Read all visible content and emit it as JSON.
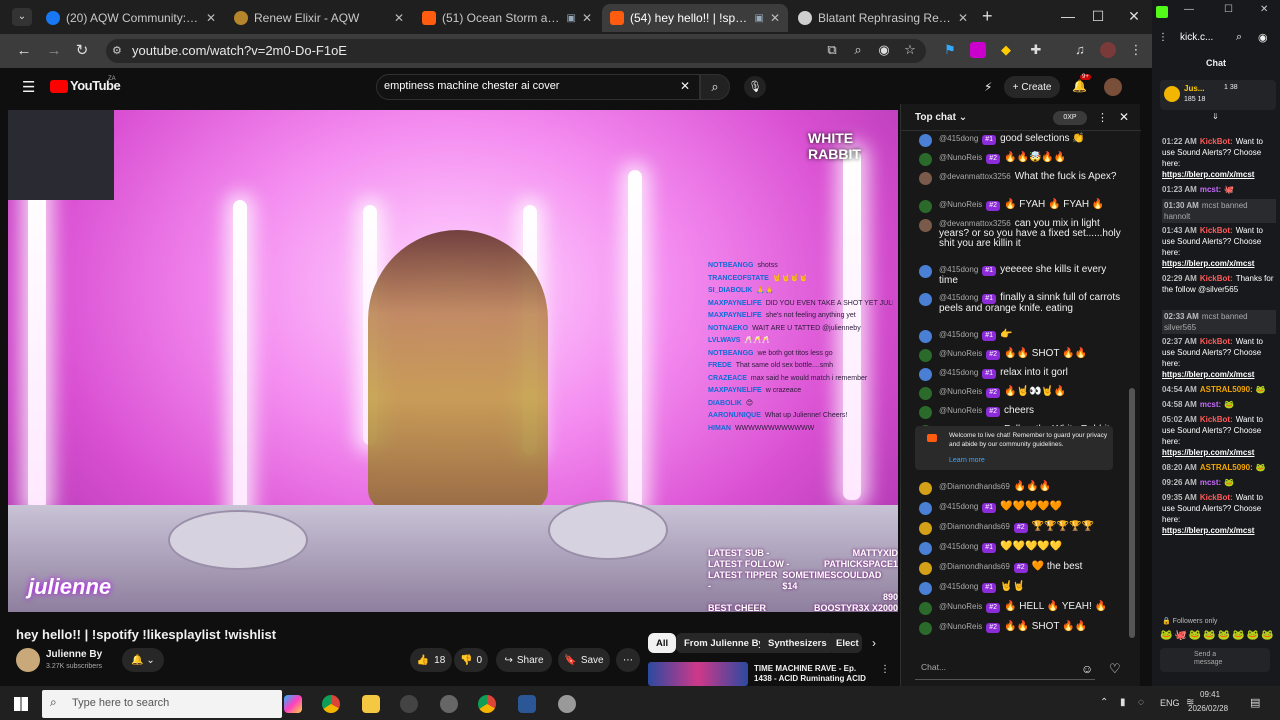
{
  "browser": {
    "tabs": [
      {
        "title": "(20) AQW Community: 🧡 LOV",
        "favicon_color": "#1877f2"
      },
      {
        "title": "Renew Elixir - AQW",
        "favicon_color": "#b5852b"
      },
      {
        "title": "(51) Ocean Storm and Rain",
        "favicon_color": "#ff5c10"
      },
      {
        "title": "(54) hey hello!! | !spotify !li",
        "favicon_color": "#ff5c10"
      },
      {
        "title": "Blatant Rephrasing Request",
        "favicon_color": "#cfcfcf"
      }
    ],
    "new_tab": "+",
    "url": "youtube.com/watch?v=2m0-Do-F1oE"
  },
  "youtube": {
    "logo": "YouTube",
    "logo_sup": "ZA",
    "search_query": "emptiness machine chester ai cover",
    "create_label": "Create",
    "notif_count": "9+",
    "video": {
      "brand_overlay": "WHITE RABBIT",
      "stream_overlay_chat": [
        {
          "user": "NOTBEANGG",
          "text": "shotss"
        },
        {
          "user": "TRANCEOFSTATE",
          "text": "🤘🤘🤘🤘"
        },
        {
          "user": "SI_DIABOLIK",
          "text": "🙏🙏"
        },
        {
          "user": "MAXPAYNELIFE",
          "text": "DID YOU EVEN TAKE A SHOT YET JULI?"
        },
        {
          "user": "MAXPAYNELIFE",
          "text": "she's not feeling anything yet"
        },
        {
          "user": "NOTNAEKO",
          "text": "WAIT ARE U TATTED @julienneby"
        },
        {
          "user": "LVLWAVS",
          "text": "🥂🥂🥂"
        },
        {
          "user": "NOTBEANGG",
          "text": "we both got titos less go"
        },
        {
          "user": "FREDE",
          "text": "That same old sex bottle....smh"
        },
        {
          "user": "CRAZEACE",
          "text": "max said he would match i remember"
        },
        {
          "user": "MAXPAYNELIFE",
          "text": "w crazeace"
        },
        {
          "user": "DIABOLIK",
          "text": "😊"
        },
        {
          "user": "AARONUNIQUE",
          "text": "What up Julienne! Cheers!"
        },
        {
          "user": "HIMAN",
          "text": "WWWWWWWWWWWW"
        }
      ],
      "stream_stats": [
        {
          "label": "LATEST SUB -",
          "value": "MATTYXID"
        },
        {
          "label": "LATEST FOLLOW -",
          "value": "PATHICKSPACE1"
        },
        {
          "label": "LATEST TIPPER -",
          "value": "SOMETIMESCOULDAD $14"
        },
        {
          "label": "",
          "value": "890"
        },
        {
          "label": "BEST CHEER",
          "value": "BOOSTYR3X X2000"
        }
      ],
      "caption_logo": "julienne"
    },
    "title": "hey hello!! | !spotify !likesplaylist !wishlist",
    "channel": "Julienne By",
    "subscribers": "3.27K subscribers",
    "likes": "18",
    "dislikes": "0",
    "share": "Share",
    "save": "Save",
    "chips": [
      "All",
      "From Julienne By",
      "Synthesizers",
      "Elect"
    ],
    "recommended_title": "TIME MACHINE RAVE - Ep. 1438 - ACID Ruminating ACID ..."
  },
  "livechat": {
    "header": "Top chat",
    "points": "0XP",
    "messages": [
      {
        "user": "@415dong",
        "badge": "#1",
        "text": "good selections 👏",
        "av": "#4a7fd6"
      },
      {
        "user": "@NunoReis",
        "badge": "#2",
        "text": "🔥🔥🤯🔥🔥",
        "av": "#2a6a2a"
      },
      {
        "user": "@devanmattox3256",
        "badge": "",
        "text": "What the fuck is Apex?",
        "av": "#7a5a4a"
      },
      {
        "user": "@NunoReis",
        "badge": "#2",
        "text": "🔥 FYAH 🔥 FYAH 🔥",
        "av": "#2a6a2a"
      },
      {
        "user": "@devanmattox3256",
        "badge": "",
        "text": "can you mix in light years? or so you have a fixed set......holy shit you are killin it",
        "av": "#7a5a4a"
      },
      {
        "user": "@415dong",
        "badge": "#1",
        "text": "yeeeee she kills it every time",
        "av": "#4a7fd6"
      },
      {
        "user": "@415dong",
        "badge": "#1",
        "text": "finally a sinnk full of carrots peels and orange knife. eating",
        "av": "#4a7fd6"
      },
      {
        "user": "@415dong",
        "badge": "#1",
        "text": "👉",
        "av": "#4a7fd6"
      },
      {
        "user": "@NunoReis",
        "badge": "#2",
        "text": "🔥🔥 SHOT 🔥🔥",
        "av": "#2a6a2a"
      },
      {
        "user": "@415dong",
        "badge": "#1",
        "text": "relax into it gorl",
        "av": "#4a7fd6"
      },
      {
        "user": "@NunoReis",
        "badge": "#2",
        "text": "🔥🤘👀🤘🔥",
        "av": "#2a6a2a"
      },
      {
        "user": "@NunoReis",
        "badge": "#2",
        "text": "cheers",
        "av": "#2a6a2a"
      },
      {
        "user": "@NunoReis",
        "badge": "#2",
        "text": "Follow the White Rabbit",
        "av": "#2a6a2a"
      },
      {
        "user": "@NunoReis",
        "badge": "#2",
        "text": "🔥🔥🔥🤘🔥🔥",
        "av": "#2a6a2a"
      }
    ],
    "notice": "Welcome to live chat! Remember to guard your privacy and abide by our community guidelines.",
    "notice_link": "Learn more",
    "messages2": [
      {
        "user": "@Diamondhands69",
        "badge": "",
        "text": "🔥🔥🔥",
        "av": "#d4a017"
      },
      {
        "user": "@415dong",
        "badge": "#1",
        "text": "🧡🧡🧡🧡🧡",
        "av": "#4a7fd6"
      },
      {
        "user": "@Diamondhands69",
        "badge": "#2",
        "text": "🏆🏆🏆🏆🏆",
        "av": "#d4a017"
      },
      {
        "user": "@415dong",
        "badge": "#1",
        "text": "💛💛💛💛💛",
        "av": "#4a7fd6"
      },
      {
        "user": "@Diamondhands69",
        "badge": "#2",
        "text": "🧡 the best",
        "av": "#d4a017"
      },
      {
        "user": "@415dong",
        "badge": "#1",
        "text": "🤘🤘",
        "av": "#4a7fd6"
      },
      {
        "user": "@NunoReis",
        "badge": "#2",
        "text": "🔥 HELL 🔥 YEAH! 🔥",
        "av": "#2a6a2a"
      },
      {
        "user": "@NunoReis",
        "badge": "#2",
        "text": "🔥🔥 SHOT 🔥🔥",
        "av": "#2a6a2a"
      }
    ],
    "input_placeholder": "Chat..."
  },
  "kick": {
    "title": "kick.c...",
    "chat_label": "Chat",
    "top_user": "Jus...",
    "top_stats1": "1 38",
    "top_stats2": "185 18",
    "messages": [
      {
        "time": "01:22 AM",
        "user": "KickBot:",
        "kind": "bot",
        "text": "Want to use Sound Alerts?? Choose here:",
        "link": "https://blerp.com/x/mcst"
      },
      {
        "time": "01:23 AM",
        "user": "mcst:",
        "kind": "user",
        "text": "🐙",
        "link": ""
      },
      {
        "time": "01:30 AM",
        "user": "",
        "kind": "ban",
        "text": "mcst banned hannolt",
        "link": ""
      },
      {
        "time": "01:43 AM",
        "user": "KickBot:",
        "kind": "bot",
        "text": "Want to use Sound Alerts?? Choose here:",
        "link": "https://blerp.com/x/mcst"
      },
      {
        "time": "02:29 AM",
        "user": "KickBot:",
        "kind": "bot",
        "text": "Thanks for the follow @silver565",
        "link": ""
      },
      {
        "time": "02:33 AM",
        "user": "",
        "kind": "ban",
        "text": "mcst banned silver565",
        "link": ""
      },
      {
        "time": "02:37 AM",
        "user": "KickBot:",
        "kind": "bot",
        "text": "Want to use Sound Alerts?? Choose here:",
        "link": "https://blerp.com/x/mcst"
      },
      {
        "time": "04:54 AM",
        "user": "ASTRAL5090:",
        "kind": "astral",
        "text": "🐸",
        "link": ""
      },
      {
        "time": "04:58 AM",
        "user": "mcst:",
        "kind": "user",
        "text": "🐸",
        "link": ""
      },
      {
        "time": "05:02 AM",
        "user": "KickBot:",
        "kind": "bot",
        "text": "Want to use Sound Alerts?? Choose here:",
        "link": "https://blerp.com/x/mcst"
      },
      {
        "time": "08:20 AM",
        "user": "ASTRAL5090:",
        "kind": "astral",
        "text": "🐸",
        "link": ""
      },
      {
        "time": "09:26 AM",
        "user": "mcst:",
        "kind": "user",
        "text": "🐸",
        "link": ""
      },
      {
        "time": "09:35 AM",
        "user": "KickBot:",
        "kind": "bot",
        "text": "Want to use Sound Alerts?? Choose here:",
        "link": "https://blerp.com/x/mcst"
      }
    ],
    "followers_only": "Followers only",
    "send_placeholder": "Send a message"
  },
  "taskbar": {
    "search_placeholder": "Type here to search",
    "lang": "ENG",
    "time": "09:41",
    "date": "2026/02/28"
  }
}
